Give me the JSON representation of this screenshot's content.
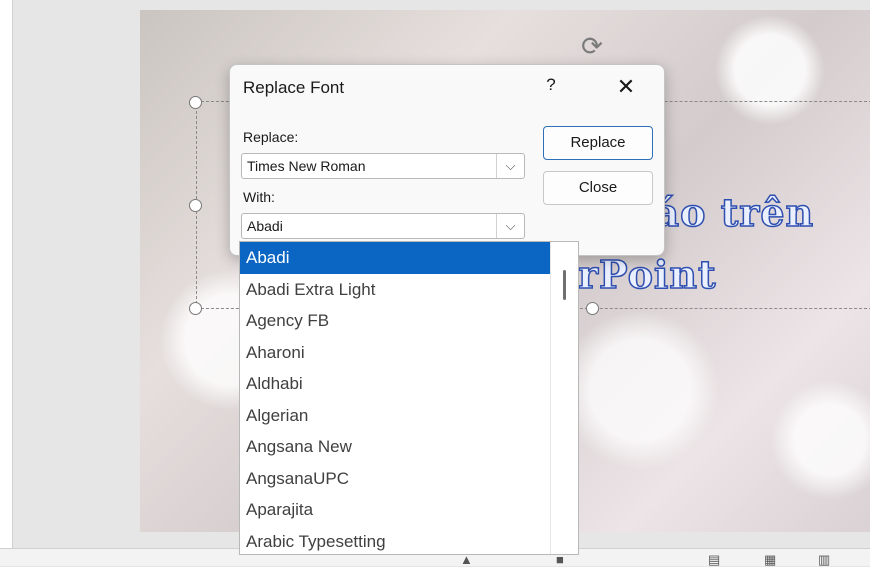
{
  "dialog": {
    "title": "Replace Font",
    "help_label": "?",
    "close_label": "✕",
    "replace_label": "Replace:",
    "replace_value": "Times New Roman",
    "with_label": "With:",
    "with_value": "Abadi",
    "replace_button": "Replace",
    "close_button": "Close"
  },
  "font_list": {
    "selected": "Abadi",
    "items": [
      "Abadi",
      "Abadi Extra Light",
      "Agency FB",
      "Aharoni",
      "Aldhabi",
      "Algerian",
      "Angsana New",
      "AngsanaUPC",
      "Aparajita",
      "Arabic Typesetting"
    ]
  },
  "slide": {
    "line1": "táo trên",
    "line2": "rPoint"
  },
  "icons": {
    "dropdown": "⌵",
    "rotate": "⟳",
    "watermark": "☼"
  },
  "colors": {
    "selection": "#0a66c2",
    "primary_border": "#2e6fb8",
    "slide_text_stroke": "#2f4fb0"
  }
}
